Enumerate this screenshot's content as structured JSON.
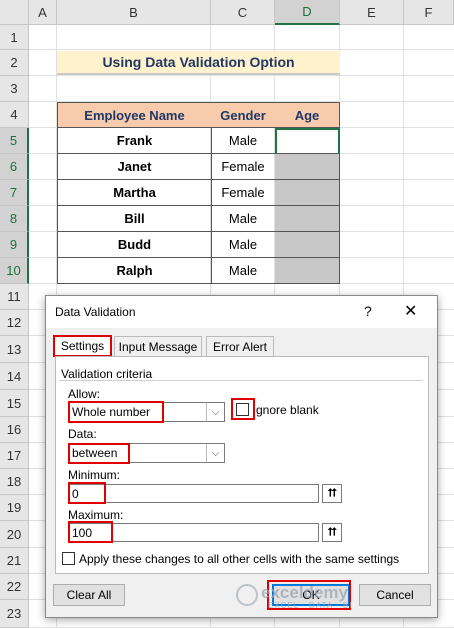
{
  "spreadsheet": {
    "columns": [
      "A",
      "B",
      "C",
      "D",
      "E",
      "F"
    ],
    "rows": [
      "1",
      "2",
      "3",
      "4",
      "5",
      "6",
      "7",
      "8",
      "9",
      "10",
      "11",
      "12",
      "13",
      "14",
      "15",
      "16",
      "17",
      "18",
      "19",
      "20",
      "21",
      "22",
      "23"
    ],
    "title": "Using Data Validation Option",
    "table_headers": [
      "Employee Name",
      "Gender",
      "Age"
    ],
    "table_rows": [
      {
        "name": "Frank",
        "gender": "Male",
        "age": ""
      },
      {
        "name": "Janet",
        "gender": "Female",
        "age": ""
      },
      {
        "name": "Martha",
        "gender": "Female",
        "age": ""
      },
      {
        "name": "Bill",
        "gender": "Male",
        "age": ""
      },
      {
        "name": "Budd",
        "gender": "Male",
        "age": ""
      },
      {
        "name": "Ralph",
        "gender": "Male",
        "age": ""
      }
    ]
  },
  "dialog": {
    "title": "Data Validation",
    "help": "?",
    "close": "✕",
    "tabs": [
      "Settings",
      "Input Message",
      "Error Alert"
    ],
    "group_label": "Validation criteria",
    "allow_label": "Allow:",
    "allow_value": "Whole number",
    "ignore_blank_label": "gnore blank",
    "data_label": "Data:",
    "data_value": "between",
    "minimum_label": "Minimum:",
    "minimum_value": "0",
    "maximum_label": "Maximum:",
    "maximum_value": "100",
    "apply_label": "Apply these changes to all other cells with the same settings",
    "clear_all": "Clear All",
    "ok": "OK",
    "cancel": "Cancel"
  },
  "watermark": {
    "name": "exceldemy",
    "sub": "EXCEL · DATA · BI"
  },
  "colors": {
    "header_fill": "#f8cbad",
    "title_fill": "#fff2cc",
    "highlight": "#e00000",
    "accent": "#217346"
  }
}
